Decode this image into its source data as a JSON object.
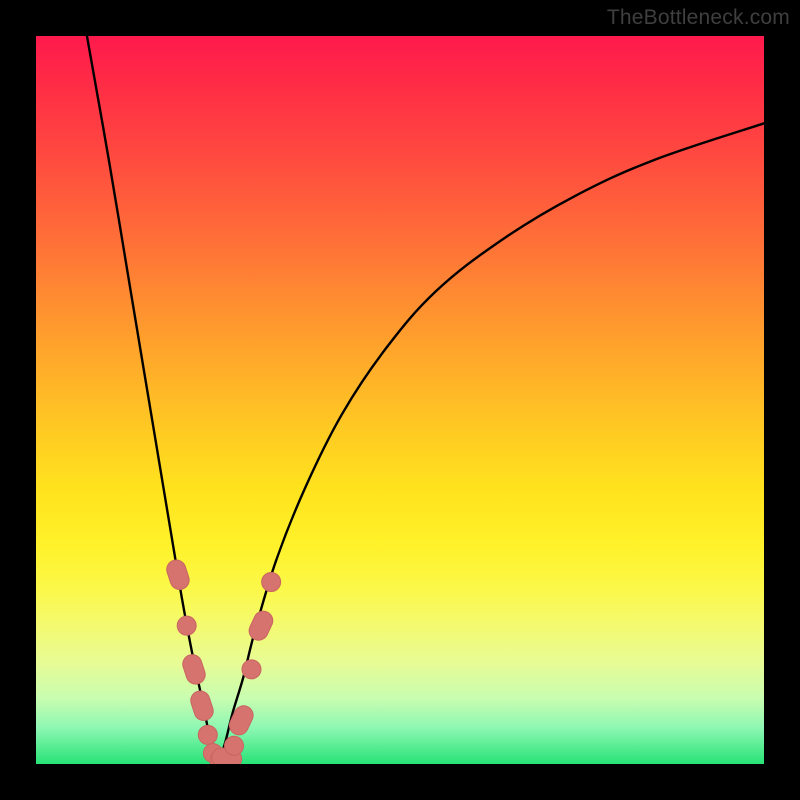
{
  "watermark": "TheBottleneck.com",
  "colors": {
    "frame": "#000000",
    "curve": "#000000",
    "marker_fill": "#d7736f",
    "marker_stroke": "#c96561"
  },
  "chart_data": {
    "type": "line",
    "title": "",
    "xlabel": "",
    "ylabel": "",
    "xlim": [
      0,
      100
    ],
    "ylim": [
      0,
      100
    ],
    "series": [
      {
        "name": "left-branch",
        "x": [
          7,
          10,
          13,
          16,
          18,
          20,
          21.5,
          23,
          24,
          25
        ],
        "y": [
          100,
          83,
          65,
          47,
          35,
          23,
          15,
          8,
          3,
          0
        ]
      },
      {
        "name": "right-branch",
        "x": [
          25,
          26,
          27,
          28.5,
          30,
          33,
          37,
          42,
          48,
          55,
          64,
          74,
          85,
          100
        ],
        "y": [
          0,
          3,
          7,
          12,
          18,
          28,
          38,
          48,
          57,
          65,
          72,
          78,
          83,
          88
        ]
      }
    ],
    "markers": [
      {
        "x": 19.5,
        "y": 26,
        "shape": "capsule",
        "orientation": "diag-left"
      },
      {
        "x": 20.7,
        "y": 19,
        "shape": "circle"
      },
      {
        "x": 21.7,
        "y": 13,
        "shape": "capsule",
        "orientation": "diag-left"
      },
      {
        "x": 22.8,
        "y": 8,
        "shape": "capsule",
        "orientation": "diag-left"
      },
      {
        "x": 23.6,
        "y": 4,
        "shape": "circle"
      },
      {
        "x": 24.3,
        "y": 1.5,
        "shape": "circle"
      },
      {
        "x": 25.2,
        "y": 0.5,
        "shape": "circle"
      },
      {
        "x": 26.2,
        "y": 0.8,
        "shape": "capsule",
        "orientation": "horiz"
      },
      {
        "x": 27.2,
        "y": 2.5,
        "shape": "circle"
      },
      {
        "x": 28.2,
        "y": 6,
        "shape": "capsule",
        "orientation": "diag-right"
      },
      {
        "x": 29.6,
        "y": 13,
        "shape": "circle"
      },
      {
        "x": 30.9,
        "y": 19,
        "shape": "capsule",
        "orientation": "diag-right"
      },
      {
        "x": 32.3,
        "y": 25,
        "shape": "circle"
      }
    ]
  }
}
